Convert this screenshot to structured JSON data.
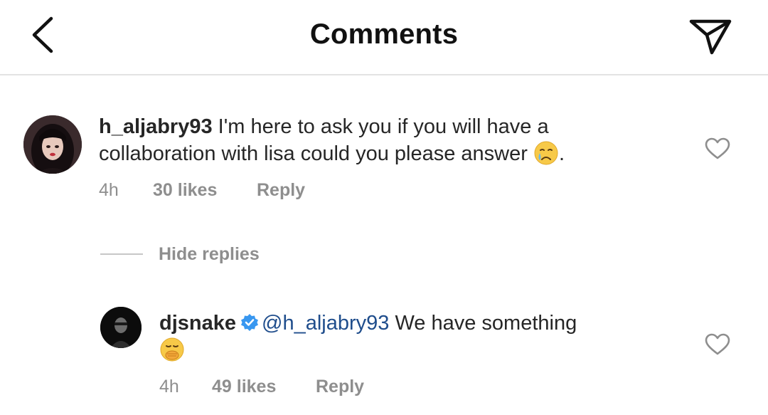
{
  "header": {
    "title": "Comments"
  },
  "comment": {
    "username": "h_aljabry93",
    "text": "I'm here to ask you if you will have a collaboration with lisa could you please answer",
    "text_suffix": ".",
    "emoji": "crying-face-emoji",
    "time": "4h",
    "likes": "30 likes",
    "reply_label": "Reply"
  },
  "thread": {
    "hide_replies_label": "Hide replies"
  },
  "reply": {
    "username": "djsnake",
    "verified": true,
    "mention": "@h_aljabry93",
    "text": "We have something",
    "emoji": "face-with-hand-over-mouth-emoji",
    "time": "4h",
    "likes": "49 likes",
    "reply_label": "Reply"
  },
  "colors": {
    "text": "#262626",
    "meta": "#8e8e8e",
    "mention": "#1f4d8c",
    "verified": "#3897f0",
    "divider": "#e3e3e3"
  }
}
